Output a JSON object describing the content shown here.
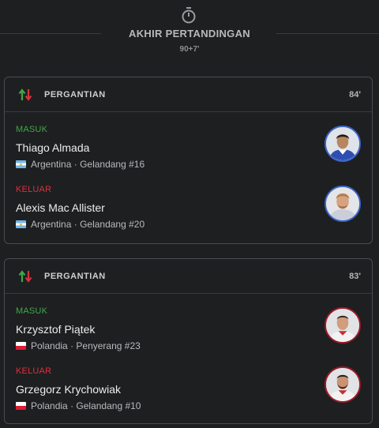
{
  "header": {
    "title": "AKHIR PERTANDINGAN",
    "time": "90+7'"
  },
  "colors": {
    "in": "#3fa84a",
    "out": "#d9323d",
    "argentina_ring": "#3b66c9",
    "poland_ring": "#9c1b28"
  },
  "events": [
    {
      "title": "PERGANTIAN",
      "minute": "84'",
      "in": {
        "status": "MASUK",
        "name": "Thiago Almada",
        "country": "Argentina",
        "sep": "·",
        "role": "Gelandang #16",
        "flag": "argentina-flag-icon"
      },
      "out": {
        "status": "KELUAR",
        "name": "Alexis Mac Allister",
        "country": "Argentina",
        "sep": "·",
        "role": "Gelandang #20",
        "flag": "argentina-flag-icon"
      }
    },
    {
      "title": "PERGANTIAN",
      "minute": "83'",
      "in": {
        "status": "MASUK",
        "name": "Krzysztof Piątek",
        "country": "Polandia",
        "sep": "·",
        "role": "Penyerang #23",
        "flag": "poland-flag-icon"
      },
      "out": {
        "status": "KELUAR",
        "name": "Grzegorz Krychowiak",
        "country": "Polandia",
        "sep": "·",
        "role": "Gelandang #10",
        "flag": "poland-flag-icon"
      }
    }
  ]
}
